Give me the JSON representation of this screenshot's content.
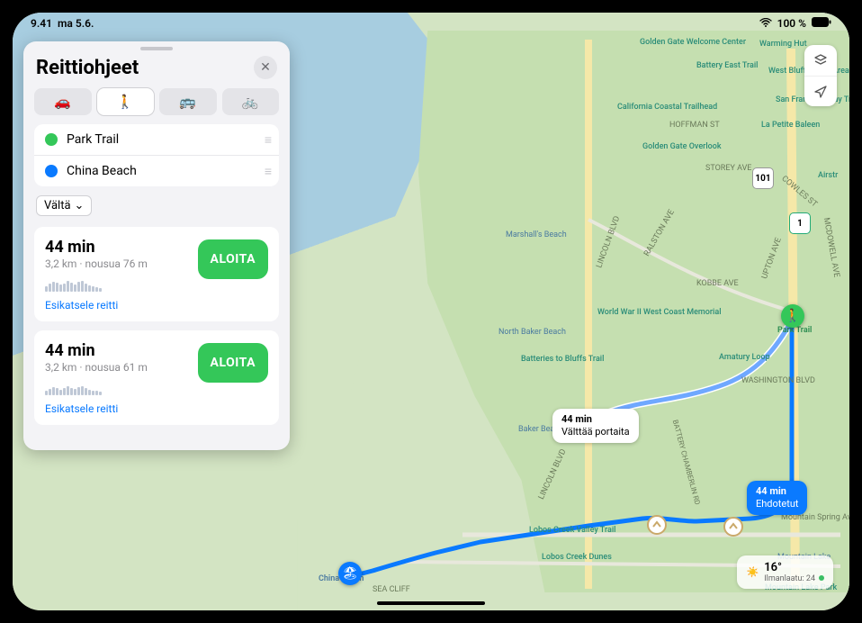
{
  "status": {
    "time": "9.41",
    "date": "ma 5.6.",
    "battery": "100 %",
    "wifi_icon": "wifi",
    "battery_icon": "battery-full"
  },
  "panel": {
    "title": "Reittiohjeet",
    "modes": {
      "car": "car",
      "walk": "walk",
      "transit": "transit",
      "bike": "bike"
    },
    "stops": {
      "from": "Park Trail",
      "to": "China Beach"
    },
    "avoid_label": "Vältä",
    "routes": [
      {
        "time": "44 min",
        "meta": "3,2 km · nousua 76 m",
        "preview": "Esikatsele reitti",
        "go": "ALOITA"
      },
      {
        "time": "44 min",
        "meta": "3,2 km · nousua 61 m",
        "preview": "Esikatsele reitti",
        "go": "ALOITA"
      }
    ]
  },
  "map": {
    "callouts": {
      "alt": {
        "time": "44 min",
        "note": "Välttää portaita"
      },
      "primary": {
        "time": "44 min",
        "note": "Ehdotetut"
      }
    },
    "highways": {
      "us101": "101",
      "ca1": "1"
    },
    "labels": {
      "golden_gate": "Golden Gate Welcome Center",
      "warming_hut": "Warming Hut",
      "battery_east": "Battery East Trail",
      "west_bluff": "West Bluff Picnic Area",
      "gg_overlook": "Golden Gate Overlook",
      "coastal_trail": "California Coastal Trailhead",
      "la_petite": "La Petite Baleen",
      "bay_trail": "San Francisco Bay Trail",
      "hoffman": "HOFFMAN ST",
      "storey": "STOREY AVE",
      "mcdowell": "MCDOWELL AVE",
      "cowles": "COWLES ST",
      "airstr": "Airstr",
      "marshalls": "Marshall's Beach",
      "lincoln": "LINCOLN BLVD",
      "ralston": "RALSTON AVE",
      "kobbe": "KOBBE AVE",
      "upton": "UPTON AVE",
      "wwii": "World War II West Coast Memorial",
      "park_trail": "Park Trail",
      "amatury": "Amatury Loop",
      "north_baker": "North Baker Beach",
      "batteries": "Batteries to Bluffs Trail",
      "baker": "Baker Beach",
      "washington": "WASHINGTON BLVD",
      "battery_chamberlin": "BATTERY CHAMBERLIN RD",
      "lobos_valley": "Lobos Creek Valley Trail",
      "lobos_dunes": "Lobos Creek Dunes",
      "china_beach": "China Beach",
      "sea_cliff": "SEA CLIFF",
      "mountain_spring": "Mountain Spring Ave",
      "mountain_lake": "Mountain Lake",
      "mountain_lake_park": "Mountain Lake Park",
      "lincoln2": "LINCOLN BLVD"
    },
    "controls": {
      "layers": "layers",
      "locate": "locate"
    },
    "weather": {
      "temp": "16°",
      "aqi_label": "Ilmanlaatu: 24"
    }
  }
}
